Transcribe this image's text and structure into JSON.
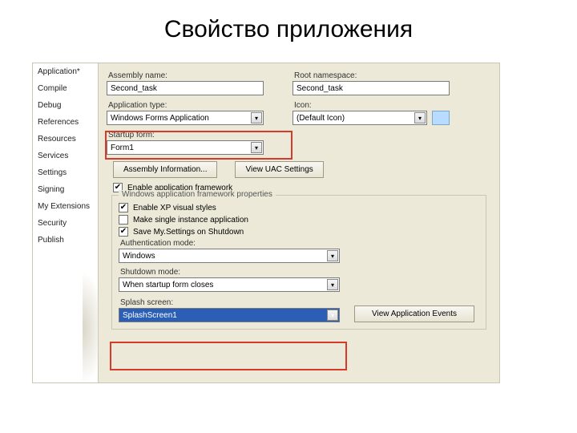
{
  "title": "Свойство приложения",
  "tabs": [
    "Application*",
    "Compile",
    "Debug",
    "References",
    "Resources",
    "Services",
    "Settings",
    "Signing",
    "My Extensions",
    "Security",
    "Publish"
  ],
  "fields": {
    "assembly_name_label": "Assembly name:",
    "assembly_name_value": "Second_task",
    "root_namespace_label": "Root namespace:",
    "root_namespace_value": "Second_task",
    "application_type_label": "Application type:",
    "application_type_value": "Windows Forms Application",
    "icon_label": "Icon:",
    "icon_value": "(Default Icon)",
    "startup_form_label": "Startup form:",
    "startup_form_value": "Form1",
    "auth_mode_label": "Authentication mode:",
    "auth_mode_value": "Windows",
    "shutdown_mode_label": "Shutdown mode:",
    "shutdown_mode_value": "When startup form closes",
    "splash_label": "Splash screen:",
    "splash_value": "SplashScreen1"
  },
  "buttons": {
    "assembly_info": "Assembly Information...",
    "view_uac": "View UAC Settings",
    "view_events": "View Application Events"
  },
  "checkboxes": {
    "enable_framework": "Enable application framework",
    "xp_styles": "Enable XP visual styles",
    "single_instance": "Make single instance application",
    "save_settings": "Save My.Settings on Shutdown"
  },
  "fieldset_legend": "Windows application framework properties"
}
